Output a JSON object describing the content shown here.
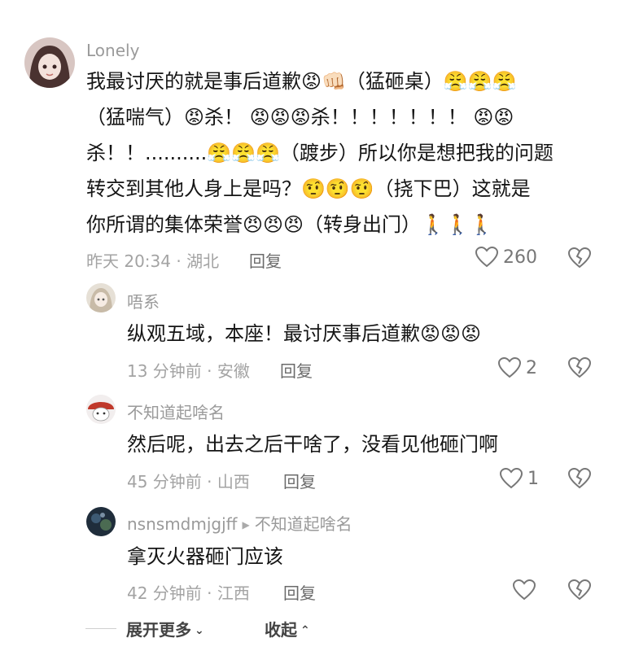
{
  "comments": [
    {
      "username": "Lonely",
      "lines": [
        "我最讨厌的就是事后道歉😡👊🏻（猛砸桌）😤😤😤",
        "（猛喘气）😡杀！ 😡😡😡杀！！！！！！！ 😡😡",
        "杀！！..........😤😤😤（踱步）所以你是想把我的问题",
        "转交到其他人身上是吗？🤨🤨🤨（挠下巴）这就是",
        "你所谓的集体荣誉😠😠😠（转身出门）🚶🚶🚶"
      ],
      "meta": "昨天 20:34 · 湖北",
      "reply_label": "回复",
      "likes": "260",
      "avatar_color": "#c9a5a0"
    },
    {
      "username": "唔系",
      "lines": [
        "纵观五域，本座！最讨厌事后道歉😡😡😡"
      ],
      "meta": "13 分钟前 · 安徽",
      "reply_label": "回复",
      "likes": "2",
      "avatar_color": "#d9d2c4"
    },
    {
      "username": "不知道起啥名",
      "lines": [
        "然后呢，出去之后干啥了，没看见他砸门啊"
      ],
      "meta": "45 分钟前 · 山西",
      "reply_label": "回复",
      "likes": "1",
      "avatar_color": "#c0392b"
    },
    {
      "username": "nsnsmdmjgjff",
      "reply_to": "不知道起啥名",
      "lines": [
        "拿灭火器砸门应该"
      ],
      "meta": "42 分钟前 · 江西",
      "reply_label": "回复",
      "likes": "",
      "avatar_color": "#2b3d4f"
    }
  ],
  "footer": {
    "expand_label": "展开更多",
    "collapse_label": "收起"
  },
  "icons": [
    "heart-icon",
    "broken-heart-icon",
    "chevron-down-icon",
    "chevron-up-icon",
    "reply-arrow-icon"
  ]
}
